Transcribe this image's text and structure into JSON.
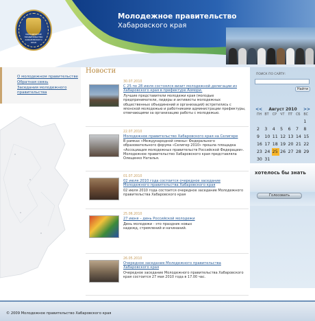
{
  "header": {
    "title_line1": "Молодежное правительство",
    "title_line2": "Хабаровского края",
    "logo_text": "МОЛОДЕЖНОЕ ПРАВИТЕЛЬСТВО ХАБАРОВСКОГО КРАЯ"
  },
  "leftnav": {
    "items": [
      {
        "label": "О молодежном правительстве"
      },
      {
        "label": "Обратная связь"
      },
      {
        "label": "Заседания молодежного правительства"
      }
    ]
  },
  "main": {
    "heading": "Новости",
    "news": [
      {
        "date": "30.07.2010",
        "title": "С 25 по 28 июля состоялся визит молодежной делегации из Хабаровского края в префектуре Аомори.",
        "text": "Лучшие представители молодежи края (молодые предприниматели, лидеры и активисты молодежных общественных объединений и организаций) встретились с японской молодежью и работниками администрации префектуры, отвечающими за организацию работы с молодежью."
      },
      {
        "date": "22.07.2010",
        "title": "Молодежное правительство Хабаровского края на Селигере",
        "text": "В рамках «Международной смены» Федерального образовательного форума «Селигер 2010» прошла площадка «Ассоциация молодежных правительств Российской Федерации». Молодежное правительство Хабаровского края представляла Олещенко Наталья."
      },
      {
        "date": "01.07.2010",
        "title": "02 июля 2010 года состоится очередное заседание Молодежного правительства Хабаровского края",
        "text": "02 июля 2010 года состоится очередное заседание Молодежного правительства Хабаровского края"
      },
      {
        "date": "25.06.2010",
        "title": "27 июня – день Российской молодежи",
        "text": "День молодежи - это праздник новых надежд, стремлений и начинаний."
      },
      {
        "date": "26.05.2010",
        "title": "Очередное заседание Молодежного правительства Хабаровского края",
        "text": "Очередное заседание Молодежного правительства Хабаровского края состоится 27 мая 2010 года в 17.00 час."
      }
    ]
  },
  "search": {
    "label": "ПОИСК ПО САЙТУ:",
    "value": "",
    "button": "Найти"
  },
  "calendar": {
    "prev": "<<",
    "next": ">>",
    "month": "Август 2010",
    "dow": [
      "ПН",
      "ВТ",
      "СР",
      "ЧТ",
      "ПТ",
      "СБ",
      "ВС"
    ],
    "weeks": [
      [
        "",
        "",
        "",
        "",
        "",
        "",
        "1"
      ],
      [
        "2",
        "3",
        "4",
        "5",
        "6",
        "7",
        "8"
      ],
      [
        "9",
        "10",
        "11",
        "12",
        "13",
        "14",
        "15"
      ],
      [
        "16",
        "17",
        "18",
        "19",
        "20",
        "21",
        "22"
      ],
      [
        "23",
        "24",
        "25",
        "26",
        "27",
        "28",
        "29"
      ],
      [
        "30",
        "31",
        "",
        "",
        "",
        "",
        ""
      ]
    ],
    "today": "25"
  },
  "poll": {
    "title": "хотелось бы знать",
    "vote_button": "Голосовать"
  },
  "footer": {
    "copyright": "© 2009 Молодежное правительство Хабаровского края"
  },
  "colors": {
    "header_blue": "#1f4f9a",
    "accent_gold": "#b8883e",
    "link_blue": "#2a5e9a",
    "today_highlight": "#f7b52a"
  }
}
